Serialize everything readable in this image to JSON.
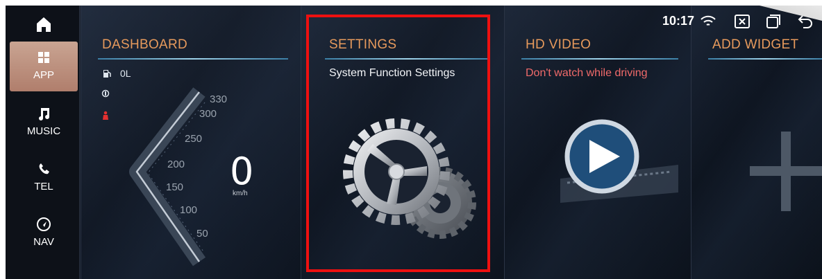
{
  "status_bar": {
    "time": "10:17"
  },
  "sidebar": {
    "items": [
      {
        "label": "APP",
        "active": true,
        "icon": "apps-grid-icon"
      },
      {
        "label": "MUSIC",
        "active": false,
        "icon": "music-note-icon"
      },
      {
        "label": "TEL",
        "active": false,
        "icon": "phone-icon"
      },
      {
        "label": "NAV",
        "active": false,
        "icon": "navigation-icon"
      }
    ]
  },
  "dashboard": {
    "title": "DASHBOARD",
    "fuel": "0L",
    "speed": "0",
    "unit": "km/h",
    "ticks": [
      "330",
      "300",
      "250",
      "200",
      "150",
      "100",
      "50"
    ]
  },
  "settings": {
    "title": "SETTINGS",
    "subtitle": "System Function Settings"
  },
  "hd_video": {
    "title": "HD VIDEO",
    "subtitle": "Don't watch while driving"
  },
  "add_widget": {
    "title": "ADD WIDGET"
  },
  "colors": {
    "accent": "#e79a5c",
    "highlight": "#ee1010",
    "warning": "#f06a6a"
  }
}
